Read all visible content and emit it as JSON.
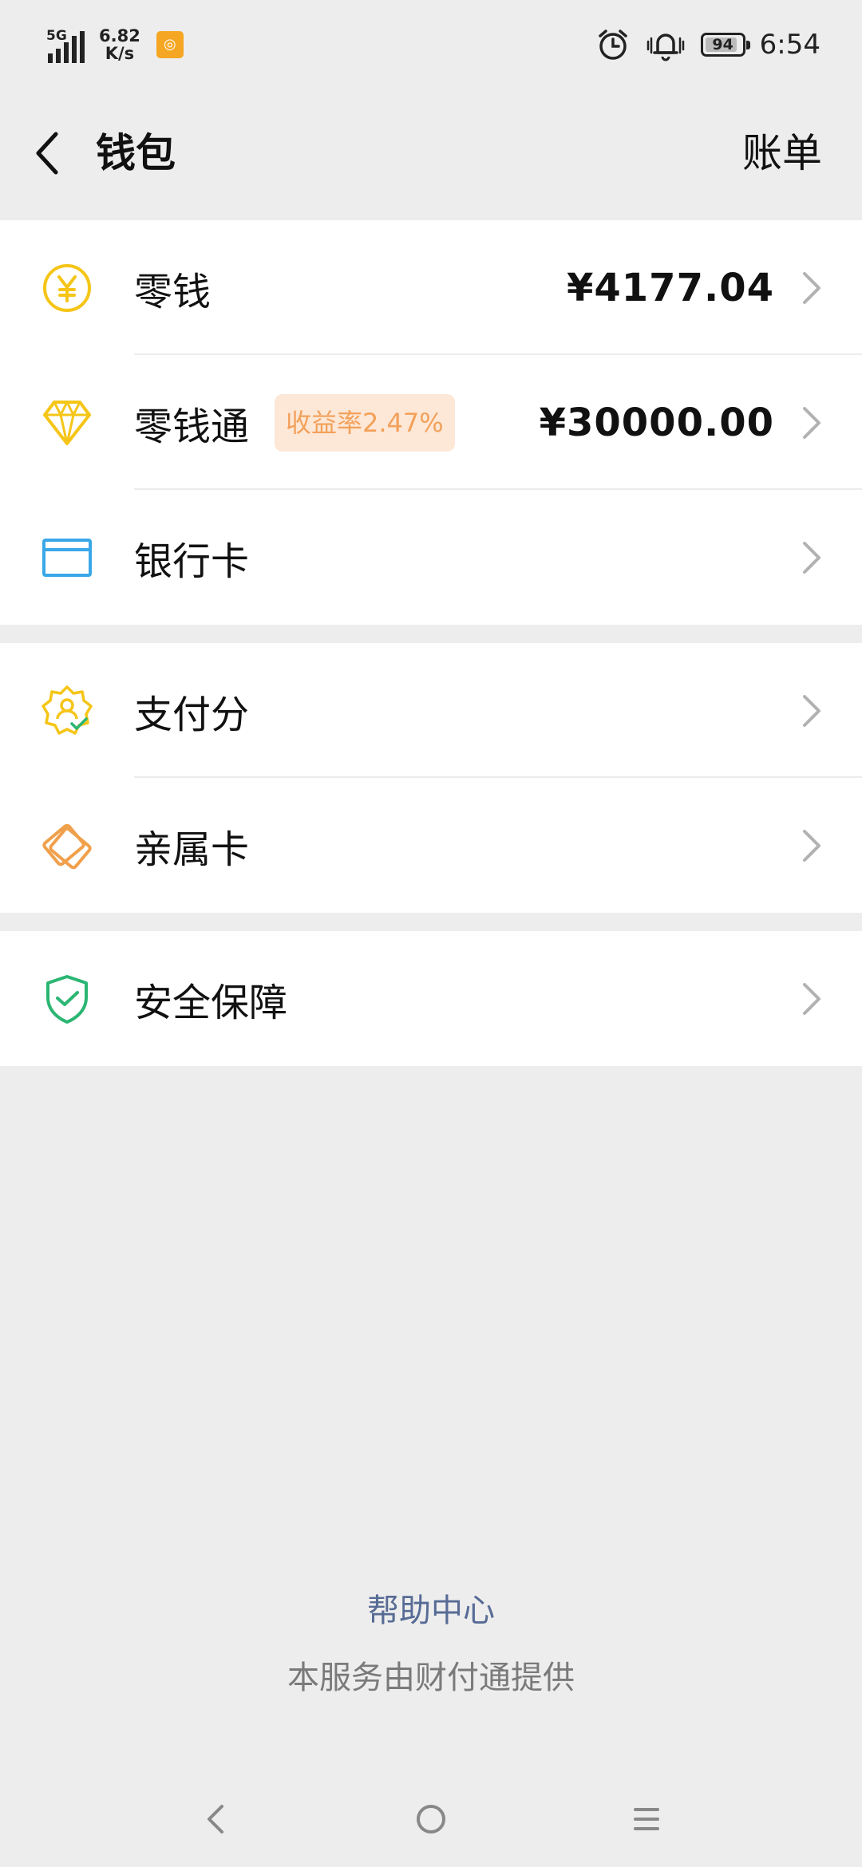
{
  "status_bar": {
    "network": "5G",
    "speed_value": "6.82",
    "speed_unit": "K/s",
    "battery": "94",
    "time": "6:54"
  },
  "header": {
    "title": "钱包",
    "bill_label": "账单"
  },
  "groups": [
    {
      "items": [
        {
          "label": "零钱",
          "amount": "¥4177.04",
          "icon": "yuan-coin-icon",
          "color": "#f5c518"
        },
        {
          "label": "零钱通",
          "badge": "收益率2.47%",
          "amount": "¥30000.00",
          "icon": "diamond-icon",
          "color": "#f5c518"
        },
        {
          "label": "银行卡",
          "icon": "bank-card-icon",
          "color": "#3aa8e8"
        }
      ]
    },
    {
      "items": [
        {
          "label": "支付分",
          "icon": "pay-score-badge-icon",
          "color": "#f5c518"
        },
        {
          "label": "亲属卡",
          "icon": "family-card-icon",
          "color": "#f0a04b"
        }
      ]
    },
    {
      "items": [
        {
          "label": "安全保障",
          "icon": "shield-check-icon",
          "color": "#2bb673"
        }
      ]
    }
  ],
  "footer": {
    "help_center": "帮助中心",
    "service_note": "本服务由财付通提供"
  },
  "colors": {
    "link": "#576b95",
    "badge_bg": "#fde7d6",
    "badge_text": "#f2a15a"
  }
}
